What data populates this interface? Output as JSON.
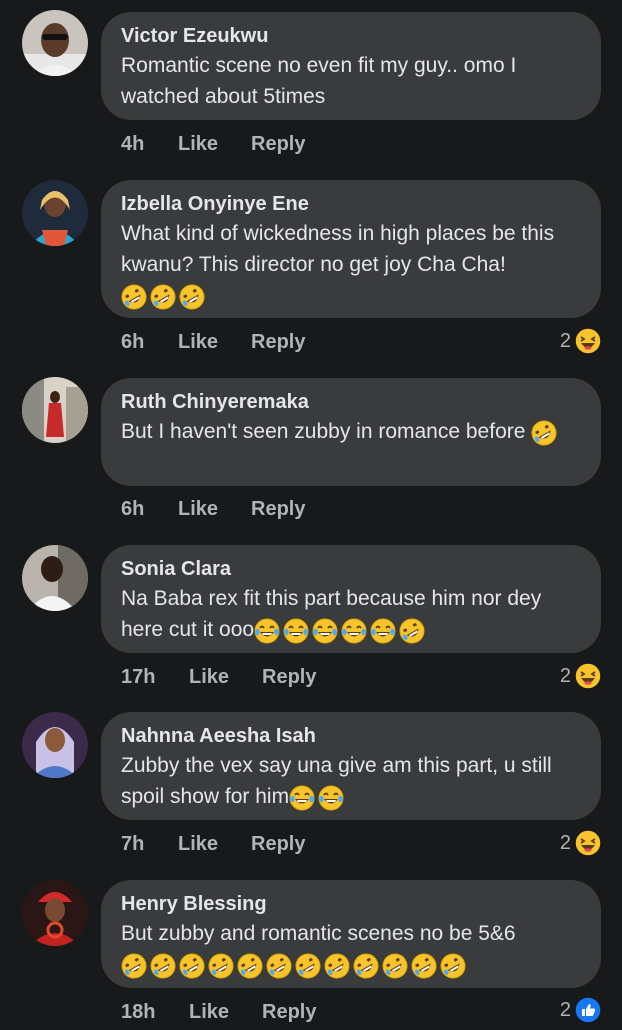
{
  "comments": [
    {
      "name": "Victor Ezeukwu",
      "text": "Romantic scene no even fit my guy.. omo I watched about 5times",
      "emojis": [],
      "time": "4h",
      "like": "Like",
      "reply": "Reply",
      "reaction_count": "",
      "reaction_icon": ""
    },
    {
      "name": "Izbella Onyinye Ene",
      "text": "What kind of wickedness in high places be this kwanu? This director no get joy Cha Cha!",
      "emojis": [
        "rolling-laugh",
        "rolling-laugh",
        "rolling-laugh"
      ],
      "time": "6h",
      "like": "Like",
      "reply": "Reply",
      "reaction_count": "2",
      "reaction_icon": "haha-icon"
    },
    {
      "name": "Ruth Chinyeremaka",
      "text": "But I haven't seen zubby in romance before",
      "emojis": [
        "rolling-laugh"
      ],
      "time": "6h",
      "like": "Like",
      "reply": "Reply",
      "reaction_count": "",
      "reaction_icon": ""
    },
    {
      "name": "Sonia Clara",
      "text": "Na Baba rex fit this part because him nor dey here cut it ooo",
      "emojis": [
        "tears-of-joy",
        "tears-of-joy",
        "tears-of-joy",
        "tears-of-joy",
        "tears-of-joy",
        "rolling-laugh"
      ],
      "time": "17h",
      "like": "Like",
      "reply": "Reply",
      "reaction_count": "2",
      "reaction_icon": "haha-icon"
    },
    {
      "name": "Nahnna Aeesha Isah",
      "text": "Zubby the vex say una give am this part, u still spoil show for him",
      "emojis": [
        "tears-of-joy",
        "tears-of-joy"
      ],
      "time": "7h",
      "like": "Like",
      "reply": "Reply",
      "reaction_count": "2",
      "reaction_icon": "haha-icon"
    },
    {
      "name": "Henry Blessing",
      "text": "But zubby and romantic scenes no be 5&6",
      "emojis": [
        "rolling-laugh",
        "rolling-laugh",
        "rolling-laugh",
        "rolling-laugh",
        "rolling-laugh",
        "rolling-laugh",
        "rolling-laugh",
        "rolling-laugh",
        "rolling-laugh",
        "rolling-laugh",
        "rolling-laugh",
        "rolling-laugh"
      ],
      "time": "18h",
      "like": "Like",
      "reply": "Reply",
      "reaction_count": "2",
      "reaction_icon": "like-icon"
    }
  ],
  "colors": {
    "background": "#18191a",
    "bubble": "#3a3b3c",
    "text": "#e4e6eb",
    "muted": "#b0b3b8",
    "emoji_yellow": "#f7c52b",
    "like_blue": "#1877f2"
  }
}
